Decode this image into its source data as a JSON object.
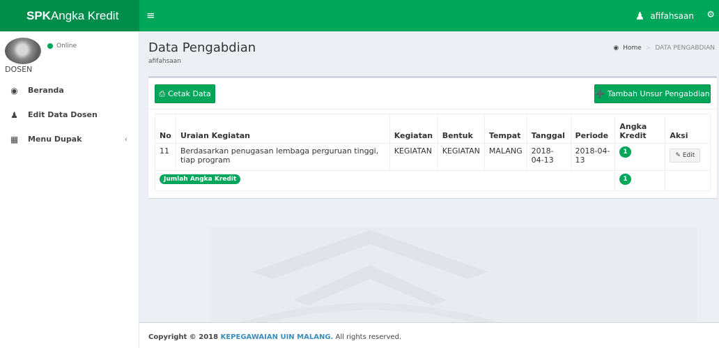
{
  "header": {
    "brand_bold": "SPK",
    "brand_rest": "Angka Kredit",
    "username": "afifahsaan",
    "hamburger_icon": "hamburger-icon",
    "user_icon": "users-icon",
    "settings_icon": "gears-icon"
  },
  "sidebar": {
    "status": "Online",
    "role": "DOSEN",
    "items": [
      {
        "label": "Beranda",
        "icon": "dashboard-icon"
      },
      {
        "label": "Edit Data Dosen",
        "icon": "user-icon"
      },
      {
        "label": "Menu Dupak",
        "icon": "grid-icon",
        "chevron": "‹"
      }
    ]
  },
  "content": {
    "title": "Data Pengabdian",
    "subtitle": "afifahsaan",
    "breadcrumb": {
      "home": "Home",
      "current": "DATA PENGABDIAN"
    },
    "cetak_label": "Cetak Data",
    "tambah_label": "Tambah Unsur Pengabdian",
    "table": {
      "headers": [
        "No",
        "Uraian Kegiatan",
        "Kegiatan",
        "Bentuk",
        "Tempat",
        "Tanggal",
        "Periode",
        "Angka Kredit",
        "Aksi"
      ],
      "rows": [
        {
          "no": "11",
          "uraian": "Berdasarkan penugasan lembaga perguruan tinggi, tiap program",
          "kegiatan": "KEGIATAN",
          "bentuk": "KEGIATAN",
          "tempat": "MALANG",
          "tanggal": "2018-04-13",
          "periode": "2018-04-13",
          "angka_kredit": "1",
          "aksi": "Edit"
        }
      ],
      "sum_label": "Jumlah Angka Kredit",
      "sum_value": "1"
    }
  },
  "footer": {
    "prefix": "Copyright © 2018 ",
    "link": "KEPEGAWAIAN UIN MALANG.",
    "suffix": " All rights reserved."
  },
  "colors": {
    "primary": "#00a65a",
    "primary_dark": "#008d4c",
    "link": "#3c8dbc",
    "background": "#ecf0f5"
  }
}
